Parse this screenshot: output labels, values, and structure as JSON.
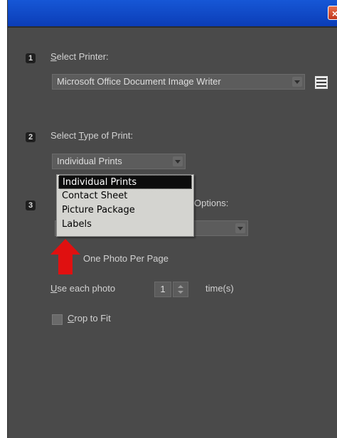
{
  "window": {
    "close_glyph": "×"
  },
  "step1": {
    "number": "1",
    "label_accel": "S",
    "label_rest": "elect Printer:",
    "printer_value": "Microsoft Office Document Image Writer",
    "settings_icon": "list-icon"
  },
  "step2": {
    "number": "2",
    "label_pre": "Select ",
    "label_accel": "T",
    "label_rest": "ype of Print:",
    "print_type_value": "Individual Prints",
    "dropdown_options": [
      "Individual Prints",
      "Contact Sheet",
      "Picture Package",
      "Labels"
    ],
    "selected_index": 0
  },
  "step3": {
    "number": "3",
    "label_visible": "Options:",
    "layout_pre": "One Photo Per Pa",
    "layout_accel": "g",
    "layout_rest": "e",
    "use_each_accel": "U",
    "use_each_rest": "se each photo",
    "times_value": "1",
    "times_suffix": "time(s)",
    "crop_accel": "C",
    "crop_rest": "rop to Fit",
    "crop_checked": true
  },
  "colors": {
    "panel_bg": "#4a4a4a",
    "titlebar": "#0b3db7",
    "close_button": "#c0361c",
    "annotation_arrow": "#e01010"
  }
}
